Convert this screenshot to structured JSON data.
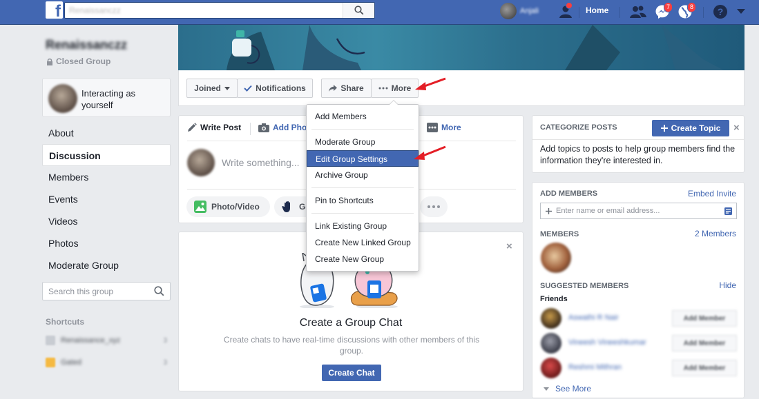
{
  "topbar": {
    "search_placeholder": "Renaissanczz",
    "username": "Anjali",
    "friend_requests_badge": "",
    "home_label": "Home",
    "messages_badge": "7",
    "notifications_badge": "8",
    "accent": "#4267b2"
  },
  "group": {
    "name": "Renaissanczz",
    "privacy": "Closed Group",
    "interacting_as": "Interacting as yourself"
  },
  "left_nav": {
    "items": [
      "About",
      "Discussion",
      "Members",
      "Events",
      "Videos",
      "Photos",
      "Moderate Group"
    ],
    "active": "Discussion",
    "search_placeholder": "Search this group",
    "shortcuts_title": "Shortcuts",
    "shortcuts": [
      {
        "label": "Renaissance_xyz",
        "count": "3"
      },
      {
        "label": "Gated",
        "count": "3"
      }
    ]
  },
  "action_bar": {
    "joined_label": "Joined",
    "notifications_label": "Notifications",
    "share_label": "Share",
    "more_label": "More"
  },
  "dropdown": {
    "items": [
      "Add Members",
      "Moderate Group",
      "Edit Group Settings",
      "Archive Group",
      "Pin to Shortcuts",
      "Link Existing Group",
      "Create New Linked Group",
      "Create New Group"
    ],
    "highlighted": "Edit Group Settings"
  },
  "composer": {
    "tab_write": "Write Post",
    "tab_photo": "Add Pho",
    "tab_more": "More",
    "placeholder": "Write something...",
    "pill_photo": "Photo/Video",
    "pill_feeling": "Ge"
  },
  "chat_card": {
    "title": "Create a Group Chat",
    "description": "Create chats to have real-time discussions with other members of this group.",
    "button": "Create Chat"
  },
  "categorize": {
    "title": "CATEGORIZE POSTS",
    "button": "Create Topic",
    "description": "Add topics to posts to help group members find the information they're interested in."
  },
  "add_members": {
    "title": "ADD MEMBERS",
    "embed_link": "Embed Invite",
    "input_placeholder": "Enter name or email address...",
    "members_title": "MEMBERS",
    "members_count": "2 Members",
    "suggested_title": "SUGGESTED MEMBERS",
    "hide_link": "Hide",
    "friends_label": "Friends",
    "suggested": [
      {
        "name": "Aswathi R Nair",
        "button": "Add Member"
      },
      {
        "name": "Vineesh Vineeshkumar",
        "button": "Add Member"
      },
      {
        "name": "Reshmi Mithran",
        "button": "Add Member"
      }
    ],
    "see_more": "See More"
  }
}
